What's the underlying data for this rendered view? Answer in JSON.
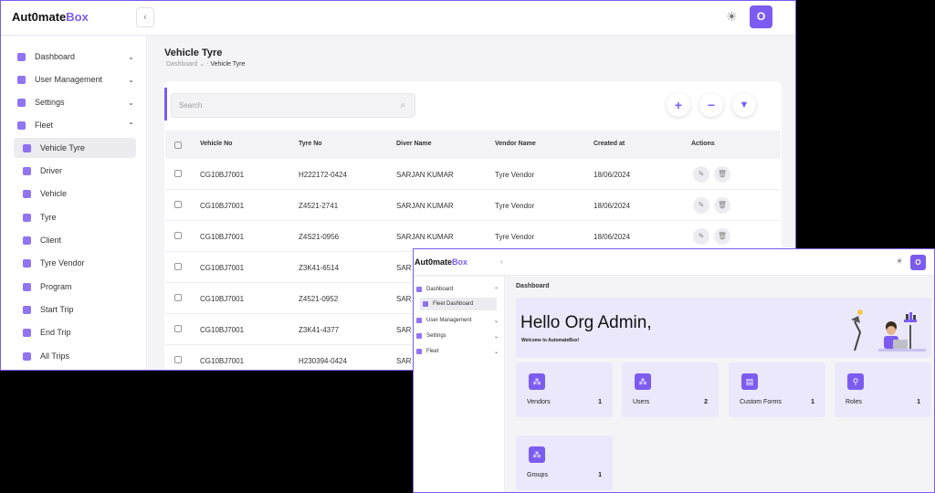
{
  "brand": {
    "logo_prefix": "Aut",
    "logo_glyph": "0",
    "logo_mid": "mate",
    "logo_suffix": "Box",
    "accent": "#7c5cf0"
  },
  "window_main": {
    "avatar_letter": "O",
    "sidebar": {
      "items": [
        {
          "label": "Dashboard",
          "icon": "dashboard-icon"
        },
        {
          "label": "User Management",
          "icon": "user-management-icon"
        },
        {
          "label": "Settings",
          "icon": "settings-icon"
        },
        {
          "label": "Fleet",
          "icon": "fleet-icon"
        }
      ],
      "fleet_items": [
        {
          "label": "Vehicle Tyre",
          "icon": "vehicle-tyre-icon"
        },
        {
          "label": "Driver",
          "icon": "driver-icon"
        },
        {
          "label": "Vehicle",
          "icon": "vehicle-icon"
        },
        {
          "label": "Tyre",
          "icon": "tyre-icon"
        },
        {
          "label": "Client",
          "icon": "client-icon"
        },
        {
          "label": "Tyre Vendor",
          "icon": "tyre-vendor-icon"
        },
        {
          "label": "Program",
          "icon": "program-icon"
        },
        {
          "label": "Start Trip",
          "icon": "start-trip-icon"
        },
        {
          "label": "End Trip",
          "icon": "end-trip-icon"
        },
        {
          "label": "All Trips",
          "icon": "all-trips-icon"
        }
      ]
    },
    "page_title": "Vehicle Tyre",
    "breadcrumb": {
      "root": "Dashboard",
      "sep": "-",
      "current": "Vehicle Tyre"
    },
    "search": {
      "placeholder": "Search"
    },
    "table": {
      "columns": [
        "Vehicle No",
        "Tyre No",
        "Diver Name",
        "Vendor Name",
        "Created at",
        "Actions"
      ],
      "rows": [
        [
          "CG10BJ7001",
          "H222172-0424",
          "SARJAN KUMAR",
          "Tyre Vendor",
          "18/06/2024"
        ],
        [
          "CG10BJ7001",
          "Z4521-2741",
          "SARJAN KUMAR",
          "Tyre Vendor",
          "18/06/2024"
        ],
        [
          "CG10BJ7001",
          "Z4S21-0956",
          "SARJAN KUMAR",
          "Tyre Vendor",
          "18/06/2024"
        ],
        [
          "CG10BJ7001",
          "Z3K41-6514",
          "SAR",
          "",
          ""
        ],
        [
          "CG10BJ7001",
          "Z4521-0952",
          "SAR",
          "",
          ""
        ],
        [
          "CG10BJ7001",
          "Z3K41-4377",
          "SAR",
          "",
          ""
        ],
        [
          "CG10BJ7001",
          "H230394-0424",
          "SAR",
          "",
          ""
        ]
      ]
    }
  },
  "window_dash": {
    "avatar_letter": "O",
    "sidebar": {
      "items": [
        {
          "label": "Dashboard",
          "icon": "dashboard-icon"
        },
        {
          "label": "Fleet Dashboard",
          "icon": "fleet-dashboard-icon"
        },
        {
          "label": "User Management",
          "icon": "user-management-icon"
        },
        {
          "label": "Settings",
          "icon": "settings-icon"
        },
        {
          "label": "Fleet",
          "icon": "fleet-icon"
        }
      ]
    },
    "heading": "Dashboard",
    "hello": {
      "title": "Hello Org Admin,",
      "subtitle": "Welcome to AutomateBox!"
    },
    "tiles": [
      {
        "label": "Vendors",
        "count": "1",
        "icon": "vendors-icon"
      },
      {
        "label": "Users",
        "count": "2",
        "icon": "users-icon"
      },
      {
        "label": "Custom Forms",
        "count": "1",
        "icon": "custom-forms-icon"
      },
      {
        "label": "Roles",
        "count": "1",
        "icon": "roles-icon"
      },
      {
        "label": "Groups",
        "count": "1",
        "icon": "groups-icon"
      }
    ]
  }
}
